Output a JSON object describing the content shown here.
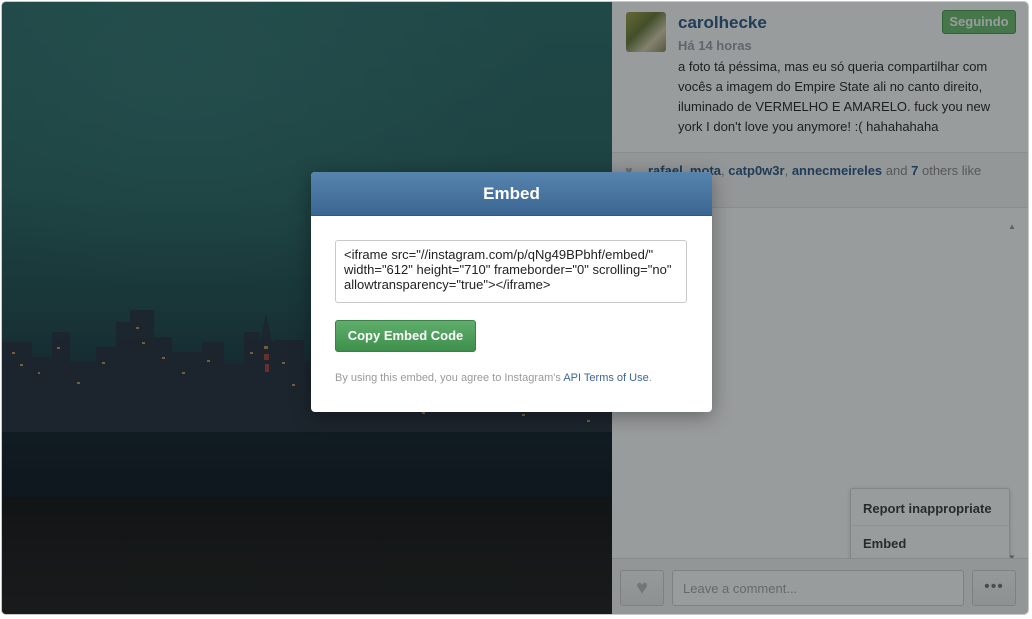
{
  "post": {
    "username": "carolhecke",
    "time": "Há 14 horas",
    "follow_label": "Seguindo",
    "caption": "a foto tá péssima, mas eu só queria compartilhar com vocês a imagem do Empire State ali no canto direito, iluminado de VERMELHO E AMARELO. fuck you new york I don't love you anymore! :( hahahahaha",
    "likers": [
      "rafael_mota",
      "catp0w3r",
      "annecmeireles"
    ],
    "likes_and": "and",
    "likes_others_count": "7",
    "likes_tail": "others like"
  },
  "icons": {
    "heart": "heart-icon",
    "more": "ellipsis-icon",
    "scroll_up": "scroll-up-arrow",
    "scroll_down": "scroll-down-arrow"
  },
  "comment": {
    "placeholder": "Leave a comment..."
  },
  "more_button_label": "•••",
  "menu": {
    "items": [
      "Report inappropriate",
      "Embed"
    ]
  },
  "modal": {
    "title": "Embed",
    "embed_code": "<iframe src=\"//instagram.com/p/qNg49BPbhf/embed/\" width=\"612\" height=\"710\" frameborder=\"0\" scrolling=\"no\" allowtransparency=\"true\"></iframe>",
    "copy_button": "Copy Embed Code",
    "terms_prefix": "By using this embed, you agree to Instagram's",
    "terms_link": "API Terms of Use",
    "terms_suffix": "."
  },
  "colors": {
    "accent_blue": "#3b6693",
    "follow_green": "#6fbf73",
    "copy_green": "#4a9a57"
  }
}
